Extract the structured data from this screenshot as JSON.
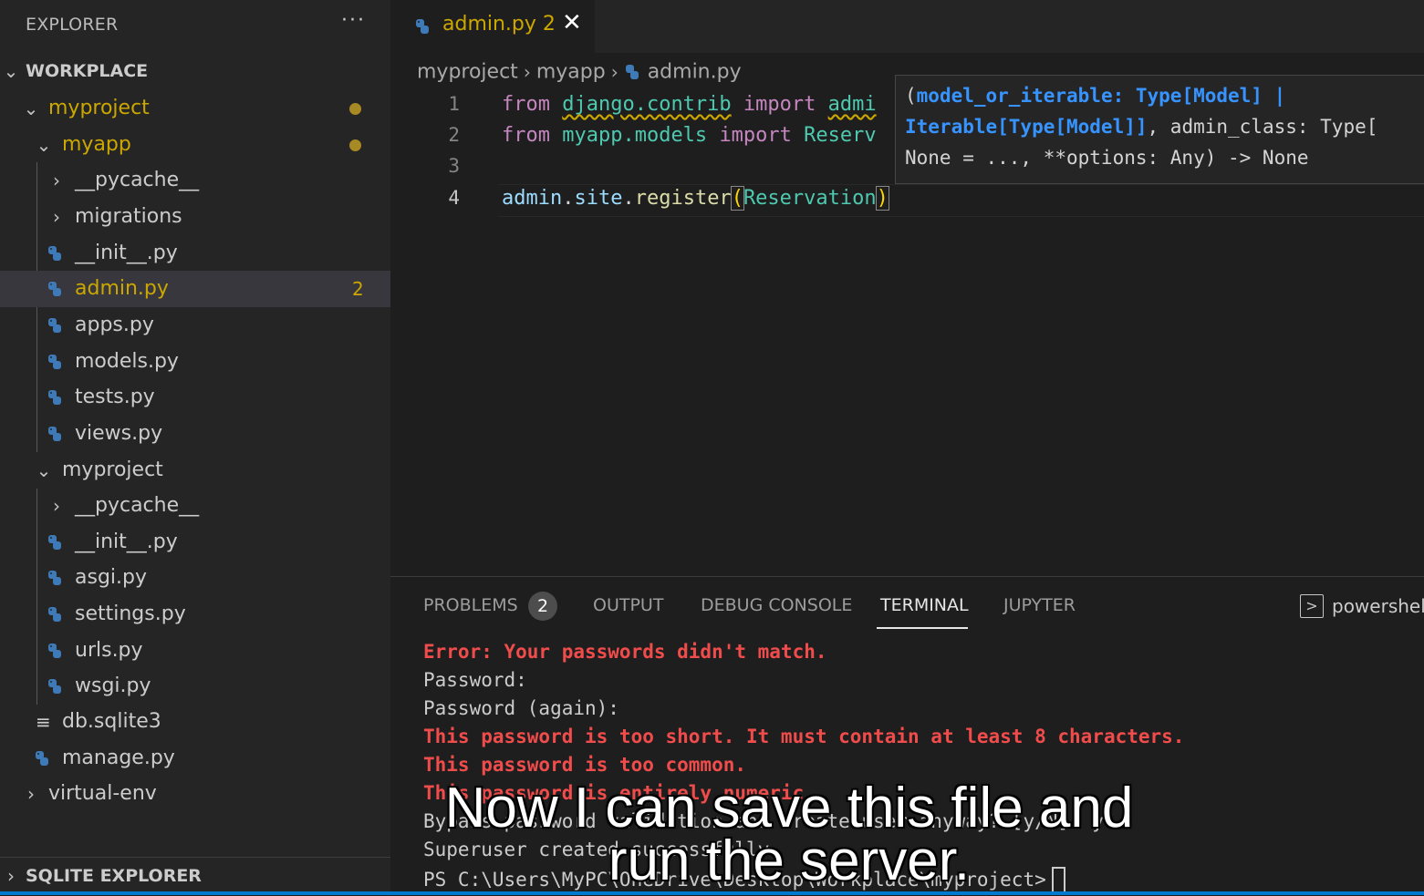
{
  "sidebar": {
    "title": "EXPLORER",
    "more": "···",
    "workspace_label": "WORKPLACE",
    "tree": {
      "myproject": "myproject",
      "myapp": "myapp",
      "pycache_1": "__pycache__",
      "migrations": "migrations",
      "init_1": "__init__.py",
      "admin": "admin.py",
      "admin_errors": "2",
      "apps": "apps.py",
      "models": "models.py",
      "tests": "tests.py",
      "views": "views.py",
      "myproject_inner": "myproject",
      "pycache_2": "__pycache__",
      "init_2": "__init__.py",
      "asgi": "asgi.py",
      "settings": "settings.py",
      "urls": "urls.py",
      "wsgi": "wsgi.py",
      "db": "db.sqlite3",
      "manage": "manage.py",
      "venv": "virtual-env"
    },
    "sqlite_explorer": "SQLITE EXPLORER"
  },
  "tab": {
    "label": "admin.py 2",
    "close": "✕"
  },
  "breadcrumb": {
    "part1": "myproject",
    "part2": "myapp",
    "part3": "admin.py"
  },
  "editor": {
    "line_numbers": [
      "1",
      "2",
      "3",
      "4"
    ],
    "line1": {
      "from": "from",
      "module": "django.contrib",
      "import": "import",
      "name": "admi"
    },
    "line2": {
      "from": "from",
      "module": "myapp.models",
      "import": "import",
      "name": "Reserv"
    },
    "line4": {
      "obj": "admin",
      "dot1": ".",
      "site": "site",
      "dot2": ".",
      "fn": "register",
      "open": "(",
      "arg": "Reservation",
      "close": ")"
    }
  },
  "hover": {
    "l1_open": "(",
    "l1_param": "model_or_iterable: Type[Model] |",
    "l2_param": "Iterable[Type[Model]]",
    "l2_rest": ", admin_class: Type[",
    "l3": "None = ..., **options: Any) -> None"
  },
  "panel": {
    "tabs": {
      "problems": "PROBLEMS",
      "problems_count": "2",
      "output": "OUTPUT",
      "debug": "DEBUG CONSOLE",
      "terminal": "TERMINAL",
      "jupyter": "JUPYTER"
    },
    "shell_icon": ">",
    "shell": "powershell",
    "terminal_lines": {
      "l1": "Error: Your passwords didn't match.",
      "l2": "Password:",
      "l3": "Password (again):",
      "l4": "This password is too short. It must contain at least 8 characters.",
      "l5": "This password is too common.",
      "l6": "This password is entirely numeric.",
      "l7": "Bypass password validation and create user anyway? [y/N]: y",
      "l8": "Superuser created successfully.",
      "l9": "PS C:\\Users\\MyPC\\OneDrive\\Desktop\\Workplace\\myproject>"
    }
  },
  "caption": {
    "line1": "Now I can save this file and",
    "line2": "run the server."
  },
  "colors": {
    "accent": "#007acc",
    "modified": "#cca700",
    "error": "#f14c4c"
  }
}
